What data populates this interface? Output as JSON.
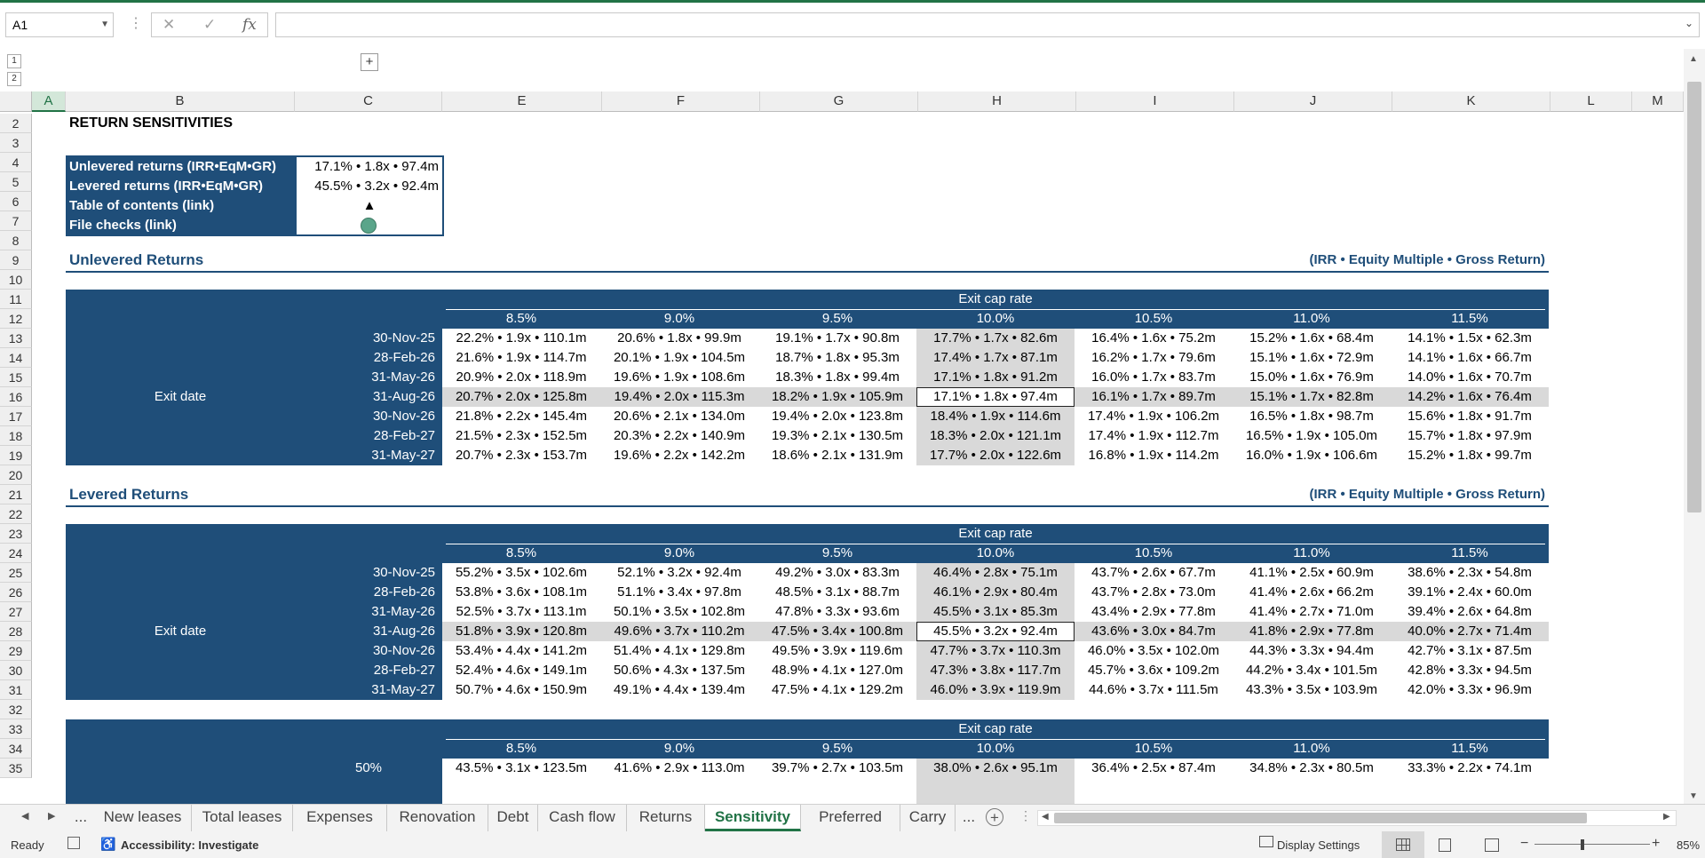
{
  "formula_bar": {
    "name_box": "A1",
    "cancel_icon": "✕",
    "enter_icon": "✓",
    "fx_label": "fx",
    "formula_value": ""
  },
  "outline": {
    "levels": [
      "1",
      "2"
    ],
    "expand_label": "+"
  },
  "columns": [
    "A",
    "B",
    "C",
    "E",
    "F",
    "G",
    "H",
    "I",
    "J",
    "K",
    "L",
    "M"
  ],
  "rows": [
    "2",
    "3",
    "4",
    "5",
    "6",
    "7",
    "8",
    "9",
    "10",
    "11",
    "12",
    "13",
    "14",
    "15",
    "16",
    "17",
    "18",
    "19",
    "20",
    "21",
    "22",
    "23",
    "24",
    "25",
    "26",
    "27",
    "28",
    "29",
    "30",
    "31",
    "32",
    "33",
    "34",
    "35"
  ],
  "sheet": {
    "title": "RETURN SENSITIVITIES",
    "summary": {
      "unlevered_label": "Unlevered returns (IRR•EqM•GR)",
      "unlevered_value": "17.1% • 1.8x • 97.4m",
      "levered_label": "Levered returns (IRR•EqM•GR)",
      "levered_value": "45.5% • 3.2x • 92.4m",
      "toc_label": "Table of contents (link)",
      "toc_symbol": "▲",
      "checks_label": "File checks (link)",
      "checks_color": "#5aa58a"
    },
    "unlevered": {
      "title": "Unlevered Returns",
      "units": "(IRR • Equity Multiple • Gross Return)",
      "col_header": "Exit cap rate",
      "row_header": "Exit date",
      "cap_rates": [
        "8.5%",
        "9.0%",
        "9.5%",
        "10.0%",
        "10.5%",
        "11.0%",
        "11.5%"
      ],
      "dates": [
        "30-Nov-25",
        "28-Feb-26",
        "31-May-26",
        "31-Aug-26",
        "30-Nov-26",
        "28-Feb-27",
        "31-May-27"
      ],
      "values": [
        [
          "22.2% • 1.9x • 110.1m",
          "20.6% • 1.8x • 99.9m",
          "19.1% • 1.7x • 90.8m",
          "17.7% • 1.7x • 82.6m",
          "16.4% • 1.6x • 75.2m",
          "15.2% • 1.6x • 68.4m",
          "14.1% • 1.5x • 62.3m"
        ],
        [
          "21.6% • 1.9x • 114.7m",
          "20.1% • 1.9x • 104.5m",
          "18.7% • 1.8x • 95.3m",
          "17.4% • 1.7x • 87.1m",
          "16.2% • 1.7x • 79.6m",
          "15.1% • 1.6x • 72.9m",
          "14.1% • 1.6x • 66.7m"
        ],
        [
          "20.9% • 2.0x • 118.9m",
          "19.6% • 1.9x • 108.6m",
          "18.3% • 1.8x • 99.4m",
          "17.1% • 1.8x • 91.2m",
          "16.0% • 1.7x • 83.7m",
          "15.0% • 1.6x • 76.9m",
          "14.0% • 1.6x • 70.7m"
        ],
        [
          "20.7% • 2.0x • 125.8m",
          "19.4% • 2.0x • 115.3m",
          "18.2% • 1.9x • 105.9m",
          "17.1% • 1.8x • 97.4m",
          "16.1% • 1.7x • 89.7m",
          "15.1% • 1.7x • 82.8m",
          "14.2% • 1.6x • 76.4m"
        ],
        [
          "21.8% • 2.2x • 145.4m",
          "20.6% • 2.1x • 134.0m",
          "19.4% • 2.0x • 123.8m",
          "18.4% • 1.9x • 114.6m",
          "17.4% • 1.9x • 106.2m",
          "16.5% • 1.8x • 98.7m",
          "15.6% • 1.8x • 91.7m"
        ],
        [
          "21.5% • 2.3x • 152.5m",
          "20.3% • 2.2x • 140.9m",
          "19.3% • 2.1x • 130.5m",
          "18.3% • 2.0x • 121.1m",
          "17.4% • 1.9x • 112.7m",
          "16.5% • 1.9x • 105.0m",
          "15.7% • 1.8x • 97.9m"
        ],
        [
          "20.7% • 2.3x • 153.7m",
          "19.6% • 2.2x • 142.2m",
          "18.6% • 2.1x • 131.9m",
          "17.7% • 2.0x • 122.6m",
          "16.8% • 1.9x • 114.2m",
          "16.0% • 1.9x • 106.6m",
          "15.2% • 1.8x • 99.7m"
        ]
      ]
    },
    "levered": {
      "title": "Levered Returns",
      "units": "(IRR • Equity Multiple • Gross Return)",
      "col_header": "Exit cap rate",
      "row_header": "Exit date",
      "cap_rates": [
        "8.5%",
        "9.0%",
        "9.5%",
        "10.0%",
        "10.5%",
        "11.0%",
        "11.5%"
      ],
      "dates": [
        "30-Nov-25",
        "28-Feb-26",
        "31-May-26",
        "31-Aug-26",
        "30-Nov-26",
        "28-Feb-27",
        "31-May-27"
      ],
      "values": [
        [
          "55.2% • 3.5x • 102.6m",
          "52.1% • 3.2x • 92.4m",
          "49.2% • 3.0x • 83.3m",
          "46.4% • 2.8x • 75.1m",
          "43.7% • 2.6x • 67.7m",
          "41.1% • 2.5x • 60.9m",
          "38.6% • 2.3x • 54.8m"
        ],
        [
          "53.8% • 3.6x • 108.1m",
          "51.1% • 3.4x • 97.8m",
          "48.5% • 3.1x • 88.7m",
          "46.1% • 2.9x • 80.4m",
          "43.7% • 2.8x • 73.0m",
          "41.4% • 2.6x • 66.2m",
          "39.1% • 2.4x • 60.0m"
        ],
        [
          "52.5% • 3.7x • 113.1m",
          "50.1% • 3.5x • 102.8m",
          "47.8% • 3.3x • 93.6m",
          "45.5% • 3.1x • 85.3m",
          "43.4% • 2.9x • 77.8m",
          "41.4% • 2.7x • 71.0m",
          "39.4% • 2.6x • 64.8m"
        ],
        [
          "51.8% • 3.9x • 120.8m",
          "49.6% • 3.7x • 110.2m",
          "47.5% • 3.4x • 100.8m",
          "45.5% • 3.2x • 92.4m",
          "43.6% • 3.0x • 84.7m",
          "41.8% • 2.9x • 77.8m",
          "40.0% • 2.7x • 71.4m"
        ],
        [
          "53.4% • 4.4x • 141.2m",
          "51.4% • 4.1x • 129.8m",
          "49.5% • 3.9x • 119.6m",
          "47.7% • 3.7x • 110.3m",
          "46.0% • 3.5x • 102.0m",
          "44.3% • 3.3x • 94.4m",
          "42.7% • 3.1x • 87.5m"
        ],
        [
          "52.4% • 4.6x • 149.1m",
          "50.6% • 4.3x • 137.5m",
          "48.9% • 4.1x • 127.0m",
          "47.3% • 3.8x • 117.7m",
          "45.7% • 3.6x • 109.2m",
          "44.2% • 3.4x • 101.5m",
          "42.8% • 3.3x • 94.5m"
        ],
        [
          "50.7% • 4.6x • 150.9m",
          "49.1% • 4.4x • 139.4m",
          "47.5% • 4.1x • 129.2m",
          "46.0% • 3.9x • 119.9m",
          "44.6% • 3.7x • 111.5m",
          "43.3% • 3.5x • 103.9m",
          "42.0% • 3.3x • 96.9m"
        ]
      ]
    },
    "third": {
      "col_header": "Exit cap rate",
      "cap_rates": [
        "8.5%",
        "9.0%",
        "9.5%",
        "10.0%",
        "10.5%",
        "11.0%",
        "11.5%"
      ],
      "first_row_label": "50%",
      "first_row_values": [
        "43.5% • 3.1x • 123.5m",
        "41.6% • 2.9x • 113.0m",
        "39.7% • 2.7x • 103.5m",
        "38.0% • 2.6x • 95.1m",
        "36.4% • 2.5x • 87.4m",
        "34.8% • 2.3x • 80.5m",
        "33.3% • 2.2x • 74.1m"
      ]
    }
  },
  "tabs": [
    "...",
    "New leases",
    "Total leases",
    "Expenses",
    "Renovation",
    "Debt",
    "Cash flow",
    "Returns",
    "Sensitivity",
    "Preferred",
    "Carry",
    "..."
  ],
  "active_tab": "Sensitivity",
  "status": {
    "ready": "Ready",
    "accessibility": "Accessibility: Investigate",
    "display_settings": "Display Settings",
    "zoom": "85%"
  }
}
